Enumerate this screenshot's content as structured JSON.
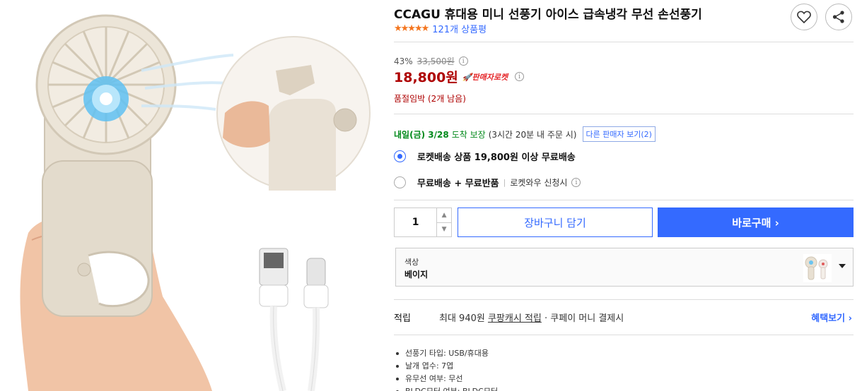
{
  "product": {
    "title": "CCAGU 휴대용 미니 선풍기 아이스 급속냉각 무선 손선풍기",
    "stars": "★★★★★",
    "review_count": "121개 상품평",
    "rating_value": 5
  },
  "price": {
    "discount_rate": "43%",
    "original": "33,500원",
    "sale": "18,800원",
    "badge": "🚀판매자로켓",
    "stock_notice": "품절임박 (2개 남음)"
  },
  "delivery": {
    "date": "내일(금) 3/28",
    "arrive": "도착 보장",
    "note": "(3시간 20분 내 주문 시)",
    "other_sellers": "다른 판매자 보기(2)"
  },
  "shipping_options": [
    {
      "label": "로켓배송 상품 19,800원 이상 무료배송",
      "sub": "",
      "selected": true
    },
    {
      "label": "무료배송 + 무료반품",
      "sub": "로켓와우 신청시",
      "selected": false
    }
  ],
  "purchase": {
    "quantity": "1",
    "cart_label": "장바구니 담기",
    "buy_label": "바로구매 ›"
  },
  "option": {
    "label": "색상",
    "value": "베이지"
  },
  "points": {
    "label": "적립",
    "text_prefix": "최대 940원 ",
    "text_link": "쿠팡캐시 적립",
    "text_suffix": " · 쿠페이 머니 결제시",
    "benefit_link": "혜택보기 ›"
  },
  "specs": [
    "선풍기 타입: USB/휴대용",
    "날개 엽수: 7엽",
    "유무선 여부: 무선",
    "BLDC모터 여부: BLDC모터"
  ],
  "icons": {
    "heart": "heart-icon",
    "share": "share-icon",
    "info": "info-icon"
  },
  "colors": {
    "accent": "#346aff",
    "price_red": "#ae0000",
    "star_orange": "#f4751e",
    "delivery_green": "#00891a"
  }
}
